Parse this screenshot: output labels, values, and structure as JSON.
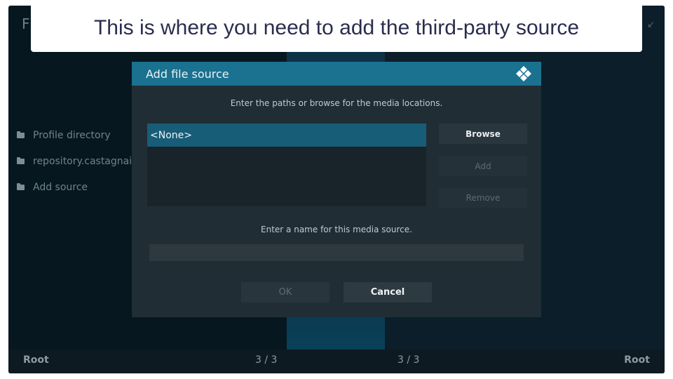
{
  "caption": "This is where you need to add the third-party source",
  "app": {
    "title_letter": "F",
    "corner_icon": "sort-icon"
  },
  "sidebar": {
    "items": [
      {
        "label": "Profile directory",
        "icon": "folder-icon"
      },
      {
        "label": "repository.castagnait",
        "icon": "folder-icon"
      },
      {
        "label": "Add source",
        "icon": "folder-icon"
      }
    ]
  },
  "bottom_bar": {
    "left": "Root",
    "center_left": "3 / 3",
    "center_right": "3 / 3",
    "right": "Root"
  },
  "dialog": {
    "title": "Add file source",
    "logo_icon": "kodi-logo-icon",
    "paths_instruction": "Enter the paths or browse for the media locations.",
    "paths": [
      "<None>"
    ],
    "buttons": {
      "browse": "Browse",
      "add": "Add",
      "remove": "Remove"
    },
    "name_instruction": "Enter a name for this media source.",
    "name_value": "",
    "ok": "OK",
    "cancel": "Cancel"
  },
  "colors": {
    "header": "#1a7190",
    "dialog_bg": "#202d34",
    "selected_row": "#185d78",
    "caption_text": "#2a2d4e"
  }
}
